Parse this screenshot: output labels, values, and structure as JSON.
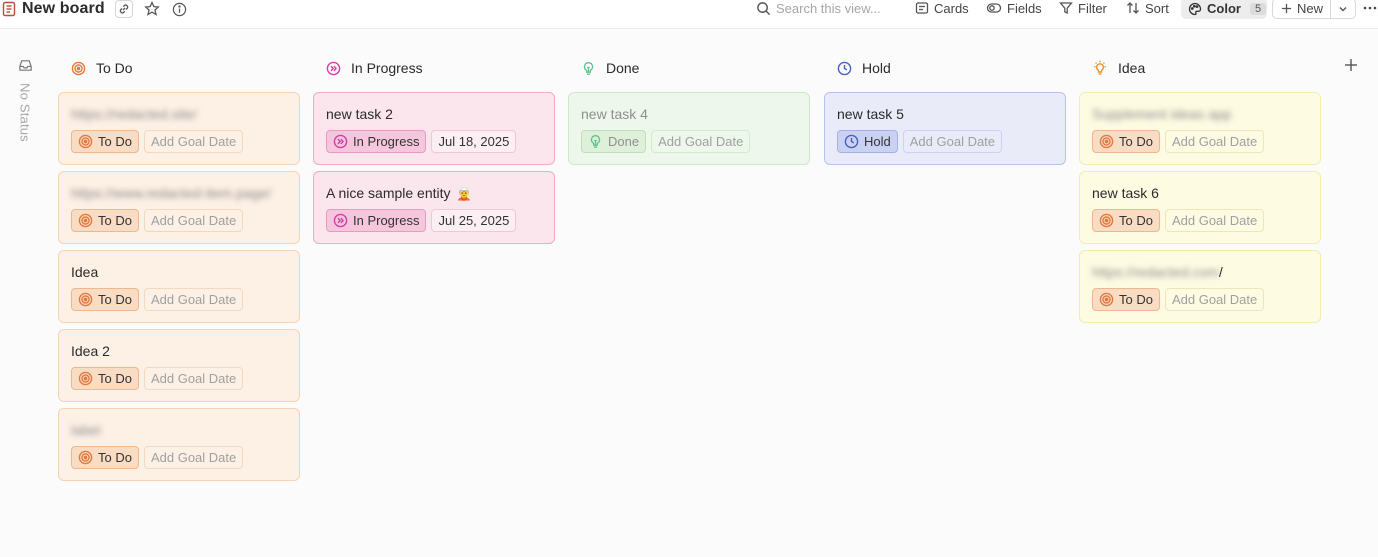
{
  "header": {
    "board_title": "New board",
    "search_placeholder": "Search this view...",
    "cards_label": "Cards",
    "fields_label": "Fields",
    "filter_label": "Filter",
    "sort_label": "Sort",
    "color_label": "Color",
    "color_count": "5",
    "new_label": "New"
  },
  "no_status_label": "No Status",
  "colors": {
    "todo": "#e07a3f",
    "in_progress": "#d03fa8",
    "done": "#5ec28a",
    "hold": "#4b5fb8",
    "idea": "#e8962a"
  },
  "columns": [
    {
      "key": "todo",
      "title": "To Do",
      "icon": "target-icon",
      "cards": [
        {
          "title": "https://redacted.site/",
          "blurred": true,
          "status": "To Do",
          "date": "Add Goal Date",
          "date_placeholder": true
        },
        {
          "title": "https://www.redacted-item.page/",
          "blurred": true,
          "status": "To Do",
          "date": "Add Goal Date",
          "date_placeholder": true
        },
        {
          "title": "Idea",
          "blurred": false,
          "status": "To Do",
          "date": "Add Goal Date",
          "date_placeholder": true
        },
        {
          "title": "Idea 2",
          "blurred": false,
          "status": "To Do",
          "date": "Add Goal Date",
          "date_placeholder": true
        },
        {
          "title": "label",
          "blurred": true,
          "status": "To Do",
          "date": "Add Goal Date",
          "date_placeholder": true
        }
      ]
    },
    {
      "key": "in_progress",
      "title": "In Progress",
      "icon": "fast-forward-circle-icon",
      "cards": [
        {
          "title": "new task 2",
          "blurred": false,
          "status": "In Progress",
          "date": "Jul 18, 2025",
          "date_placeholder": false
        },
        {
          "title": "A nice sample entity",
          "emoji": "🧝",
          "blurred": false,
          "status": "In Progress",
          "date": "Jul 25, 2025",
          "date_placeholder": false
        }
      ]
    },
    {
      "key": "done",
      "title": "Done",
      "icon": "lightbulb-outline-icon",
      "cards": [
        {
          "title": "new task 4",
          "blurred": false,
          "muted": true,
          "status": "Done",
          "date": "Add Goal Date",
          "date_placeholder": true
        }
      ]
    },
    {
      "key": "hold",
      "title": "Hold",
      "icon": "clock-icon",
      "cards": [
        {
          "title": "new task 5",
          "blurred": false,
          "status": "Hold",
          "date": "Add Goal Date",
          "date_placeholder": true
        }
      ]
    },
    {
      "key": "idea",
      "title": "Idea",
      "icon": "lightbulb-icon",
      "cards": [
        {
          "title": "Supplement ideas app",
          "blurred": true,
          "status": "To Do",
          "date": "Add Goal Date",
          "date_placeholder": true
        },
        {
          "title": "new task 6",
          "blurred": false,
          "status": "To Do",
          "date": "Add Goal Date",
          "date_placeholder": true
        },
        {
          "title": "https://redacted.com",
          "blurred": true,
          "suffix": "/",
          "status": "To Do",
          "date": "Add Goal Date",
          "date_placeholder": true
        }
      ]
    }
  ]
}
